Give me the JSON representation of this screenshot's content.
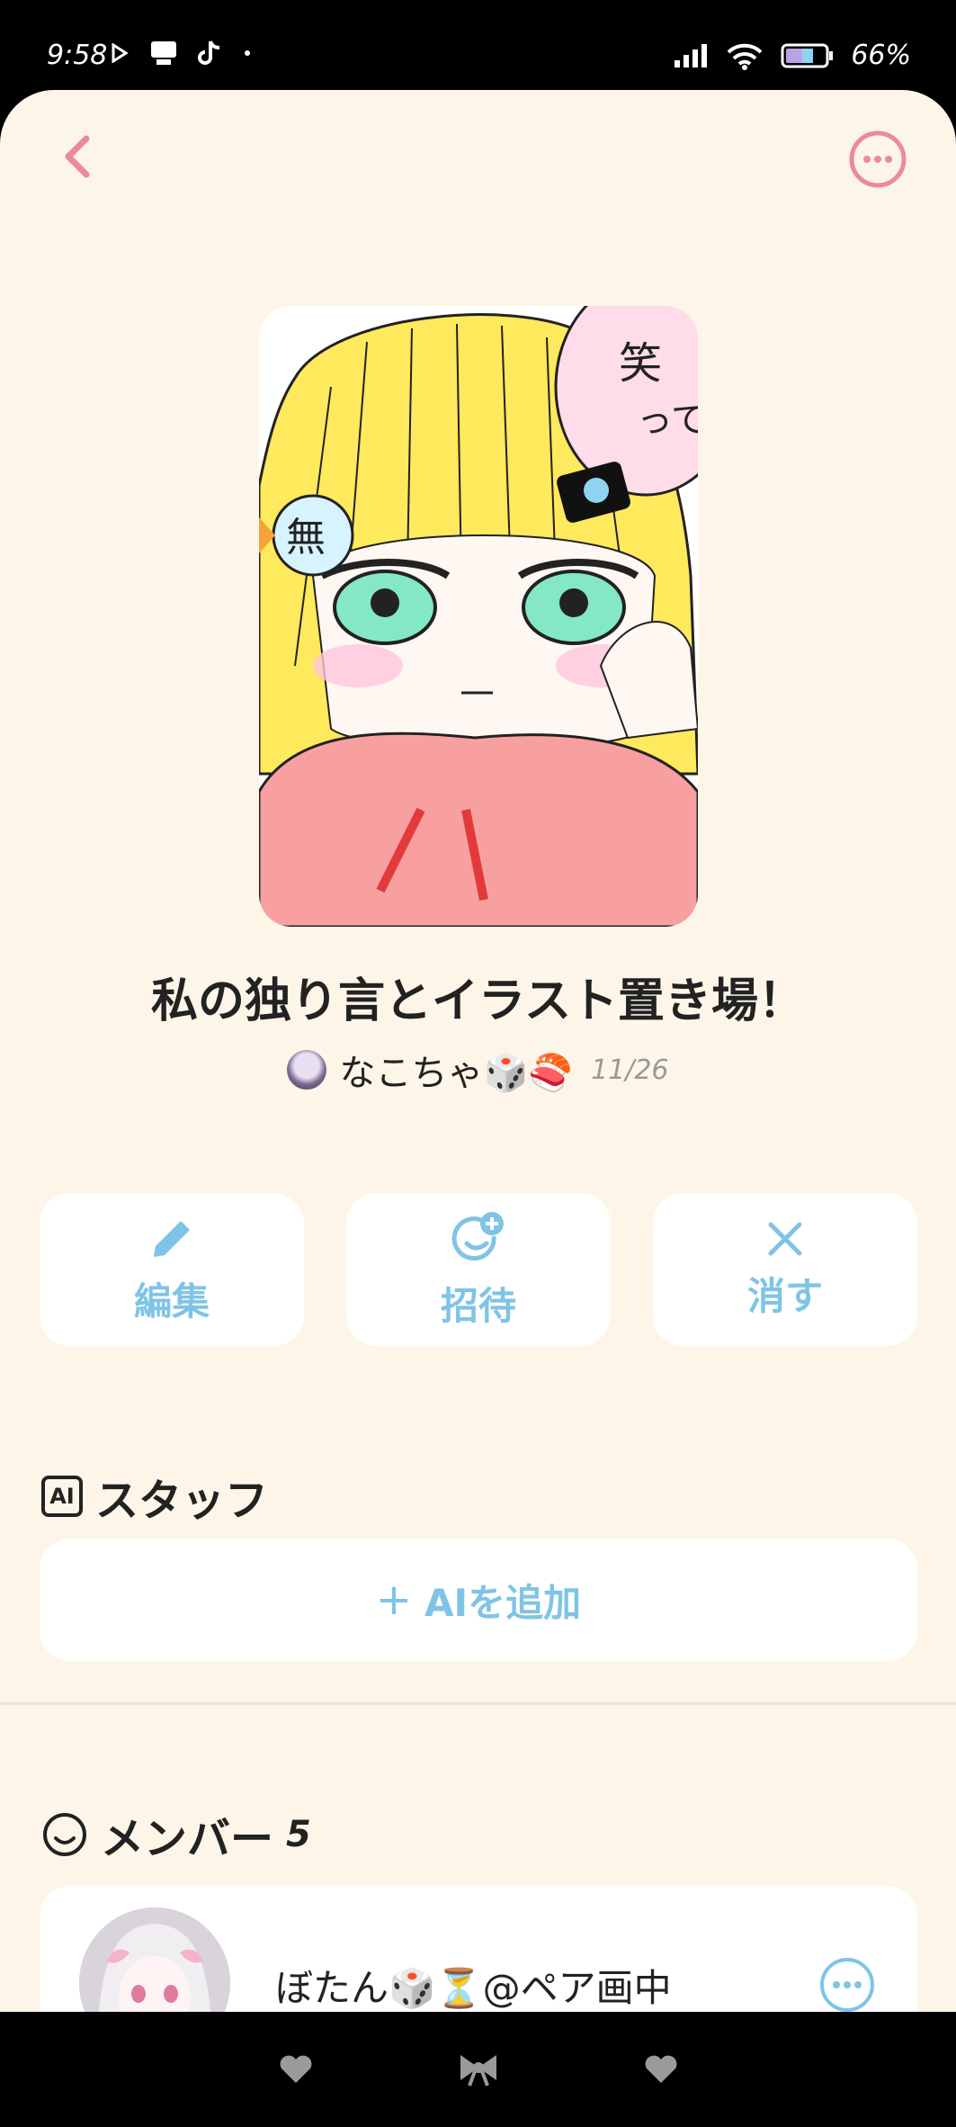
{
  "status_bar": {
    "time": "9:58",
    "battery": "66%"
  },
  "header": {
    "back_icon": "chevron-left-icon",
    "more_icon": "ellipsis-circle-icon"
  },
  "post": {
    "title": "私の独り言とイラスト置き場！",
    "author": "なこちゃ🎲🍣",
    "date": "11/26"
  },
  "actions": [
    {
      "label": "編集",
      "icon": "pencil-icon"
    },
    {
      "label": "招待",
      "icon": "invite-smile-plus-icon"
    },
    {
      "label": "消す",
      "icon": "close-icon"
    }
  ],
  "staff": {
    "badge": "AI",
    "title": "スタッフ",
    "add_plus": "+",
    "add_label": "AIを追加"
  },
  "members": {
    "title": "メンバー",
    "count": "5",
    "list": [
      {
        "name": "ぼたん🎲⏳@ペア画中"
      }
    ]
  },
  "colors": {
    "accent_blue": "#7fc4e6",
    "accent_pink": "#ec8a9a",
    "background": "#fdf6e8"
  }
}
